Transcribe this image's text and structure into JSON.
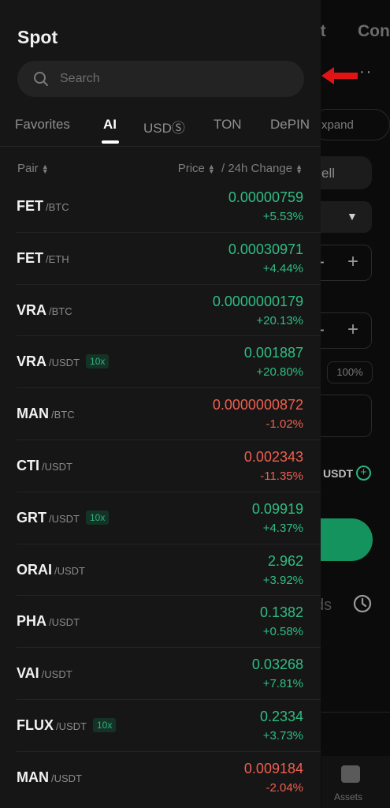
{
  "background": {
    "tab_partial_1": "at",
    "tab_partial_2": "Con",
    "more_icon": "ellipsis-icon",
    "expand_label": "xpand",
    "sell_label": "ell",
    "pct_label": "100%",
    "usdt_label": "USDT",
    "ds_label": "ds",
    "assets_label": "Assets"
  },
  "drawer": {
    "title": "Spot",
    "search": {
      "placeholder": "Search"
    },
    "tabs": [
      {
        "label": "Favorites",
        "active": false
      },
      {
        "label": "AI",
        "active": true
      },
      {
        "label": "USDⓈ",
        "active": false
      },
      {
        "label": "TON",
        "active": false
      },
      {
        "label": "DePIN",
        "active": false
      }
    ],
    "columns": {
      "pair": "Pair",
      "price_change": "Price ⬍ / 24h Change"
    },
    "col_pair": "Pair",
    "col_price": "Price",
    "col_change": "/ 24h Change",
    "rows": [
      {
        "base": "FET",
        "quote": "/BTC",
        "leverage": "",
        "price": "0.00000759",
        "change": "+5.53%",
        "trend": "up"
      },
      {
        "base": "FET",
        "quote": "/ETH",
        "leverage": "",
        "price": "0.00030971",
        "change": "+4.44%",
        "trend": "up"
      },
      {
        "base": "VRA",
        "quote": "/BTC",
        "leverage": "",
        "price": "0.0000000179",
        "change": "+20.13%",
        "trend": "up"
      },
      {
        "base": "VRA",
        "quote": "/USDT",
        "leverage": "10x",
        "price": "0.001887",
        "change": "+20.80%",
        "trend": "up"
      },
      {
        "base": "MAN",
        "quote": "/BTC",
        "leverage": "",
        "price": "0.0000000872",
        "change": "-1.02%",
        "trend": "down"
      },
      {
        "base": "CTI",
        "quote": "/USDT",
        "leverage": "",
        "price": "0.002343",
        "change": "-11.35%",
        "trend": "down"
      },
      {
        "base": "GRT",
        "quote": "/USDT",
        "leverage": "10x",
        "price": "0.09919",
        "change": "+4.37%",
        "trend": "up"
      },
      {
        "base": "ORAI",
        "quote": "/USDT",
        "leverage": "",
        "price": "2.962",
        "change": "+3.92%",
        "trend": "up"
      },
      {
        "base": "PHA",
        "quote": "/USDT",
        "leverage": "",
        "price": "0.1382",
        "change": "+0.58%",
        "trend": "up"
      },
      {
        "base": "VAI",
        "quote": "/USDT",
        "leverage": "",
        "price": "0.03268",
        "change": "+7.81%",
        "trend": "up"
      },
      {
        "base": "FLUX",
        "quote": "/USDT",
        "leverage": "10x",
        "price": "0.2334",
        "change": "+3.73%",
        "trend": "up"
      },
      {
        "base": "MAN",
        "quote": "/USDT",
        "leverage": "",
        "price": "0.009184",
        "change": "-2.04%",
        "trend": "down"
      }
    ]
  },
  "colors": {
    "up": "#2ebd85",
    "down": "#ef5f4f",
    "accent_green": "#15935f",
    "annotation_arrow": "#e01414"
  }
}
